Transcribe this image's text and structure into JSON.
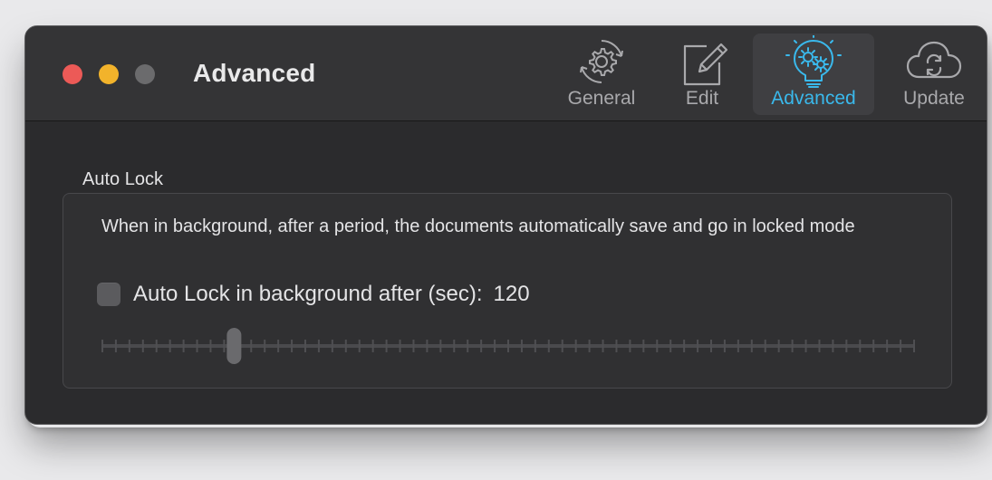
{
  "window": {
    "title": "Advanced"
  },
  "toolbar": {
    "items": [
      {
        "label": "General",
        "icon": "gear-icon",
        "active": false
      },
      {
        "label": "Edit",
        "icon": "edit-icon",
        "active": false
      },
      {
        "label": "Advanced",
        "icon": "lightbulb-gears-icon",
        "active": true
      },
      {
        "label": "Update",
        "icon": "cloud-sync-icon",
        "active": false
      }
    ]
  },
  "auto_lock": {
    "section_title": "Auto Lock",
    "description": "When in background, after a period, the documents automatically save and go in locked mode",
    "checkbox_label": "Auto Lock in background after (sec):",
    "checkbox_checked": false,
    "value": "120",
    "slider": {
      "value_fraction": 0.163,
      "tick_count": 61
    }
  },
  "colors": {
    "accent": "#3ab9ec",
    "close": "#ec5a57",
    "minimize": "#f2b32b",
    "zoom_disabled": "#6b6b6d"
  }
}
